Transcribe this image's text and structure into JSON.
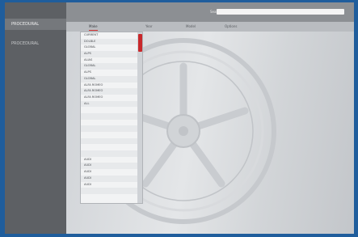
{
  "sidebar": {
    "items": [
      {
        "label": "PROCEDURAL"
      },
      {
        "label": "PROCEDURAL"
      },
      {
        "label": ""
      },
      {
        "label": ""
      },
      {
        "label": ""
      }
    ]
  },
  "search": {
    "label": "Search",
    "placeholder": ""
  },
  "tabs": [
    {
      "label": "Make"
    },
    {
      "label": "Year"
    },
    {
      "label": "Model"
    },
    {
      "label": "Options"
    }
  ],
  "dropdown": {
    "items": [
      "CURRENT",
      "DOLBLE",
      "GLOBAL",
      "ALPS",
      "ALIAS",
      "GLOBAL",
      "ALPS",
      "GLOBAL",
      "ALFA ROMEO",
      "ALFA ROMEO",
      "ALFA ROMEO",
      "ALL",
      "",
      "",
      "",
      "",
      "",
      "",
      "",
      "",
      "AUDI",
      "AUDI",
      "AUDI",
      "AUDI",
      "AUDI",
      "",
      ""
    ]
  },
  "fab": {
    "icon": "plus-icon",
    "glyph": "+",
    "label": ""
  },
  "colors": {
    "accent": "#cc2e2e",
    "fab": "#4caf50",
    "frame": "#1f5d9c"
  }
}
